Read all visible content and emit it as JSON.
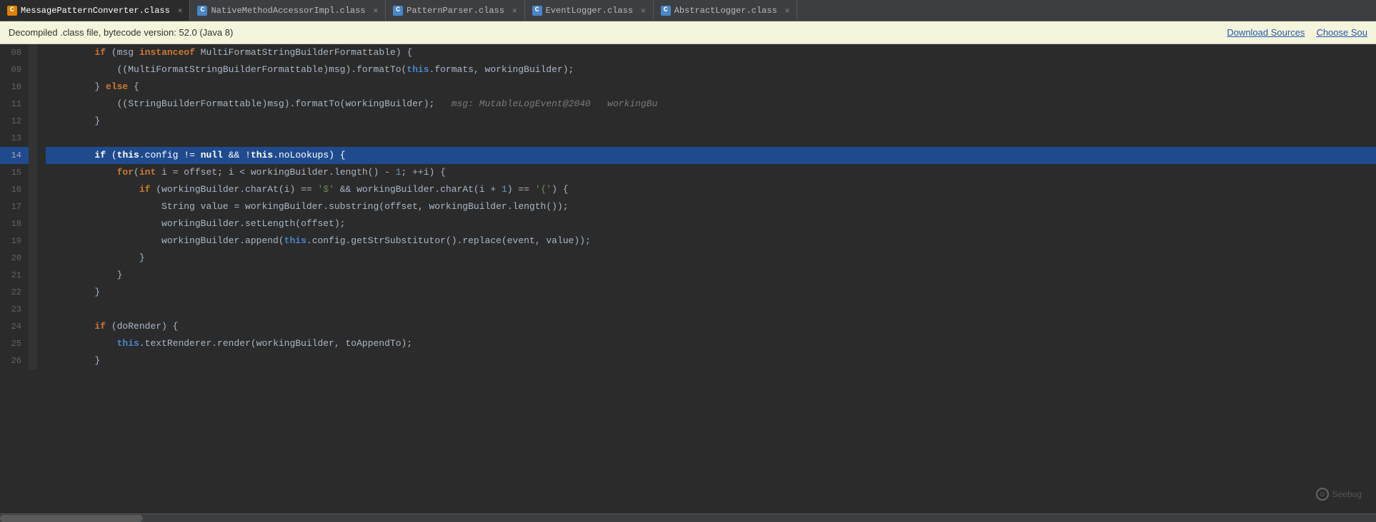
{
  "tabs": [
    {
      "id": "tab1",
      "icon_type": "orange",
      "icon_label": "C",
      "label": "MessagePatternConverter.class",
      "active": true
    },
    {
      "id": "tab2",
      "icon_type": "blue",
      "icon_label": "C",
      "label": "NativeMethodAccessorImpl.class",
      "active": false
    },
    {
      "id": "tab3",
      "icon_type": "blue",
      "icon_label": "C",
      "label": "PatternParser.class",
      "active": false
    },
    {
      "id": "tab4",
      "icon_type": "blue",
      "icon_label": "C",
      "label": "EventLogger.class",
      "active": false
    },
    {
      "id": "tab5",
      "icon_type": "blue",
      "icon_label": "C",
      "label": "AbstractLogger.class",
      "active": false
    }
  ],
  "info_bar": {
    "text": "Decompiled .class file, bytecode version: 52.0 (Java 8)",
    "download_sources_label": "Download Sources",
    "choose_source_label": "Choose Sou"
  },
  "watermark": {
    "label": "Seebug"
  },
  "code_lines": [
    {
      "num": "08",
      "content": "        if (msg instanceof MultiFormatStringBuilderFormattable) {",
      "highlighted": false
    },
    {
      "num": "09",
      "content": "            ((MultiFormatStringBuilderFormattable)msg).formatTo(this.formats, workingBuilder);",
      "highlighted": false
    },
    {
      "num": "10",
      "content": "        } else {",
      "highlighted": false
    },
    {
      "num": "11",
      "content": "            ((StringBuilderFormattable)msg).formatTo(workingBuilder);   msg: MutableLogEvent@2040   workingBu",
      "highlighted": false,
      "has_hint": true
    },
    {
      "num": "12",
      "content": "        }",
      "highlighted": false
    },
    {
      "num": "13",
      "content": "",
      "highlighted": false
    },
    {
      "num": "14",
      "content": "        if (this.config != null && !this.noLookups) {",
      "highlighted": true
    },
    {
      "num": "15",
      "content": "            for(int i = offset; i < workingBuilder.length() - 1; ++i) {",
      "highlighted": false
    },
    {
      "num": "16",
      "content": "                if (workingBuilder.charAt(i) == '$' && workingBuilder.charAt(i + 1) == '{') {",
      "highlighted": false
    },
    {
      "num": "17",
      "content": "                    String value = workingBuilder.substring(offset, workingBuilder.length());",
      "highlighted": false
    },
    {
      "num": "18",
      "content": "                    workingBuilder.setLength(offset);",
      "highlighted": false
    },
    {
      "num": "19",
      "content": "                    workingBuilder.append(this.config.getStrSubstitutor().replace(event, value));",
      "highlighted": false
    },
    {
      "num": "20",
      "content": "                }",
      "highlighted": false
    },
    {
      "num": "21",
      "content": "            }",
      "highlighted": false
    },
    {
      "num": "22",
      "content": "        }",
      "highlighted": false
    },
    {
      "num": "23",
      "content": "",
      "highlighted": false
    },
    {
      "num": "24",
      "content": "        if (doRender) {",
      "highlighted": false
    },
    {
      "num": "25",
      "content": "            this.textRenderer.render(workingBuilder, toAppendTo);",
      "highlighted": false
    },
    {
      "num": "26",
      "content": "        }",
      "highlighted": false
    }
  ]
}
